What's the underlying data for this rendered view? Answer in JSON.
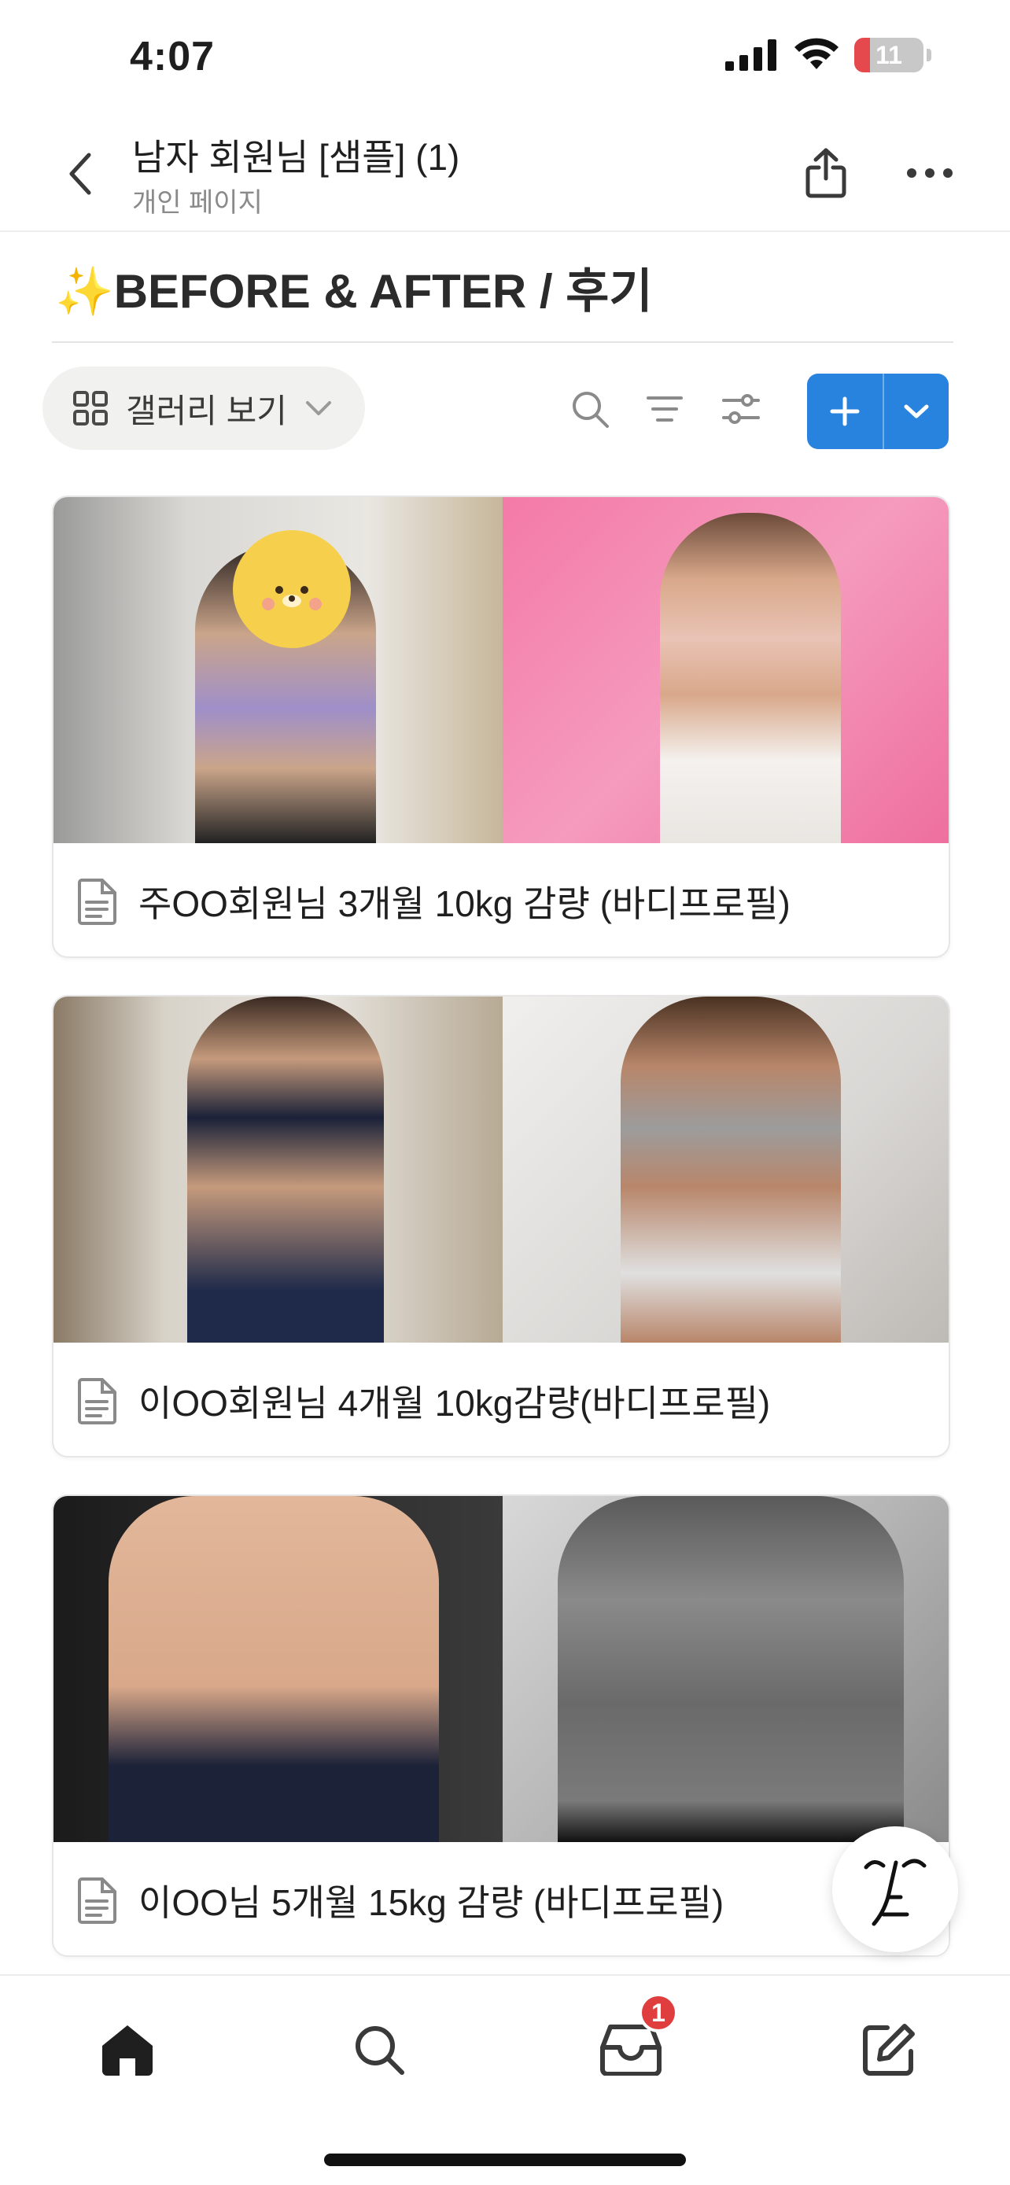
{
  "status_bar": {
    "time": "4:07",
    "battery": "11"
  },
  "header": {
    "title": "남자 회원님 [샘플] (1)",
    "subtitle": "개인 페이지"
  },
  "page": {
    "title": "✨BEFORE & AFTER / 후기"
  },
  "toolbar": {
    "view_label": "갤러리 보기"
  },
  "cards": [
    {
      "caption": "주OO회원님 3개월 10kg 감량 (바디프로필)"
    },
    {
      "caption": "이OO회원님 4개월 10kg감량(바디프로필)"
    },
    {
      "caption": "이OO님 5개월 15kg 감량 (바디프로필)"
    }
  ],
  "tabbar": {
    "inbox_badge": "1"
  },
  "colors": {
    "accent": "#2783de",
    "badge": "#e03e3e"
  }
}
